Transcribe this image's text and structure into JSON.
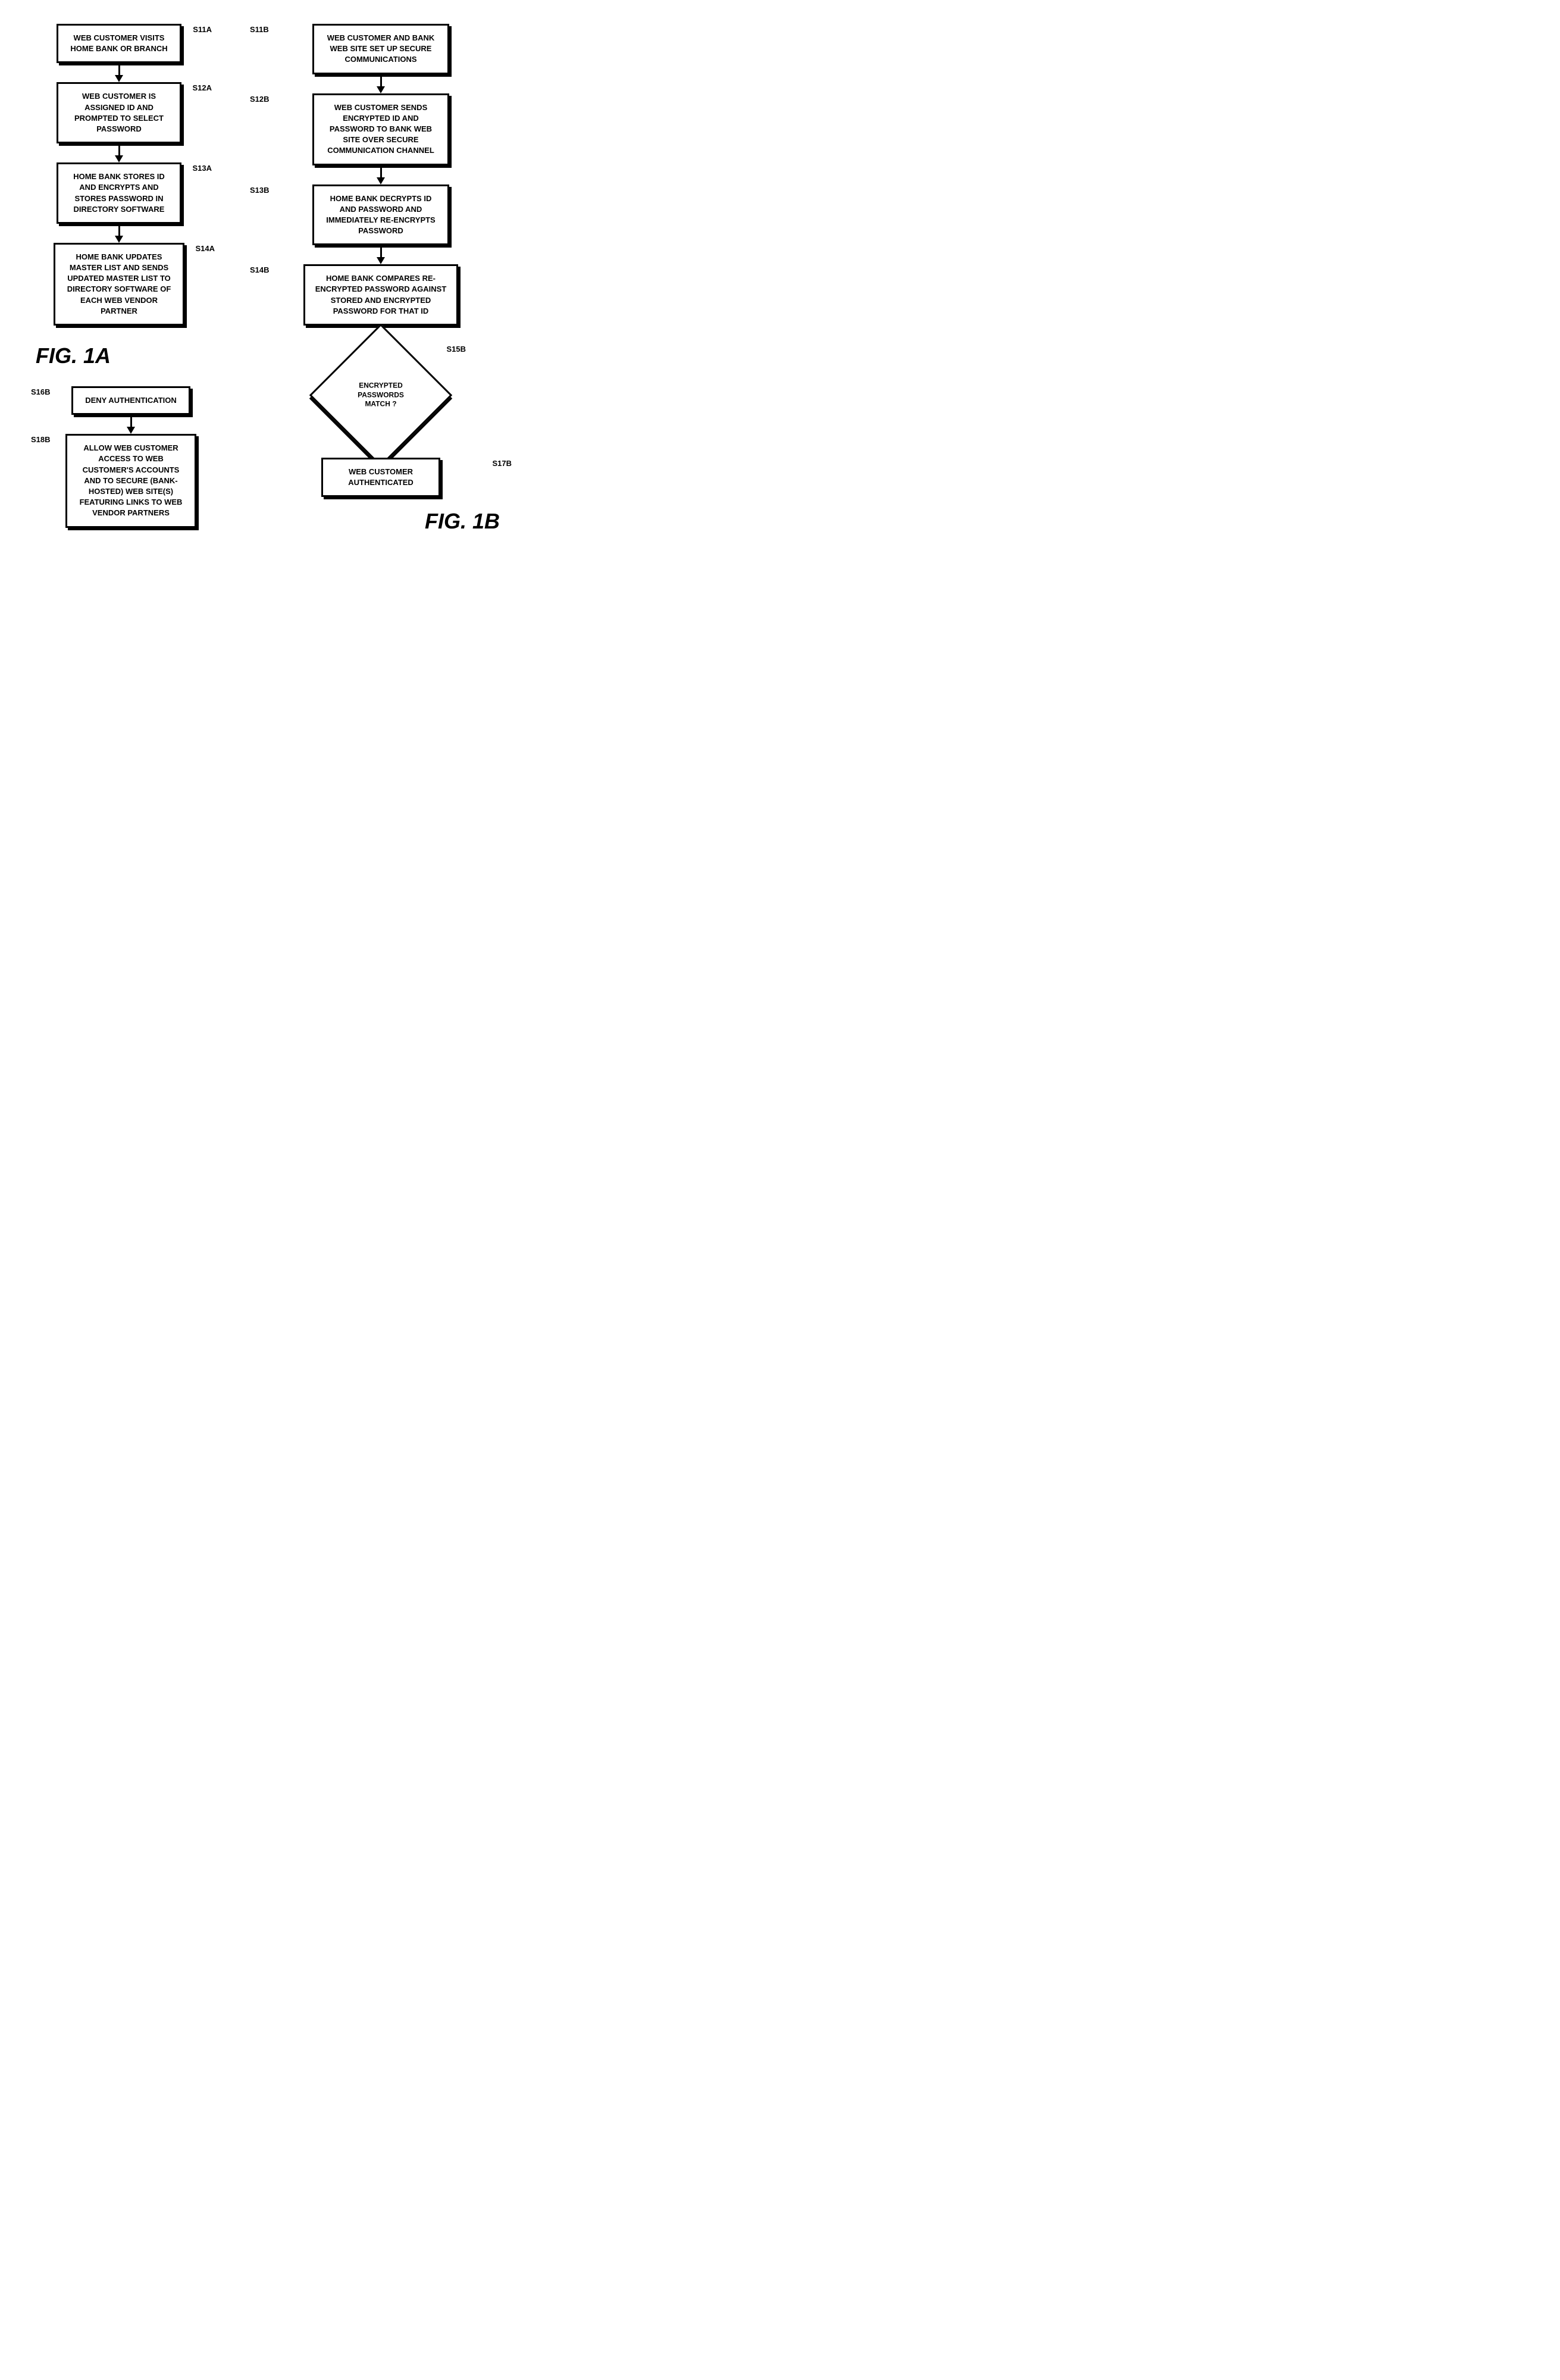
{
  "figure": {
    "fig1a_label": "FIG. 1A",
    "fig1b_label": "FIG. 1B"
  },
  "left_column": {
    "steps": [
      {
        "id": "s11a",
        "label": "S11A",
        "text": "WEB CUSTOMER VISITS HOME BANK OR BRANCH"
      },
      {
        "id": "s12a",
        "label": "S12A",
        "text": "WEB CUSTOMER IS ASSIGNED ID AND PROMPTED TO SELECT PASSWORD"
      },
      {
        "id": "s13a",
        "label": "S13A",
        "text": "HOME BANK STORES ID AND ENCRYPTS AND STORES PASSWORD IN DIRECTORY SOFTWARE"
      },
      {
        "id": "s14a",
        "label": "S14A",
        "text": "HOME BANK UPDATES MASTER LIST AND SENDS UPDATED MASTER LIST TO DIRECTORY SOFTWARE OF EACH WEB VENDOR PARTNER"
      }
    ]
  },
  "right_column": {
    "steps": [
      {
        "id": "s11b",
        "label": "S11B",
        "text": "WEB CUSTOMER AND BANK WEB SITE SET UP SECURE COMMUNICATIONS"
      },
      {
        "id": "s12b",
        "label": "S12B",
        "text": "WEB CUSTOMER SENDS ENCRYPTED ID AND PASSWORD TO BANK WEB SITE OVER SECURE COMMUNICATION CHANNEL"
      },
      {
        "id": "s13b",
        "label": "S13B",
        "text": "HOME BANK DECRYPTS ID AND PASSWORD AND IMMEDIATELY RE-ENCRYPTS PASSWORD"
      },
      {
        "id": "s14b",
        "label": "S14B",
        "text": "HOME BANK COMPARES RE-ENCRYPTED PASSWORD AGAINST STORED AND ENCRYPTED PASSWORD FOR THAT ID"
      }
    ],
    "diamond": {
      "id": "s15b",
      "label": "S15B",
      "text": "ENCRYPTED PASSWORDS MATCH ?"
    },
    "deny": {
      "id": "s16b",
      "label": "S16B",
      "text": "DENY AUTHENTICATION"
    },
    "authenticated": {
      "id": "s17b",
      "label": "S17B",
      "text": "WEB CUSTOMER AUTHENTICATED"
    },
    "allow": {
      "id": "s18b",
      "label": "S18B",
      "text": "ALLOW WEB CUSTOMER ACCESS TO WEB CUSTOMER'S ACCOUNTS AND TO SECURE (BANK-HOSTED) WEB SITE(S) FEATURING LINKS TO WEB VENDOR PARTNERS"
    }
  }
}
